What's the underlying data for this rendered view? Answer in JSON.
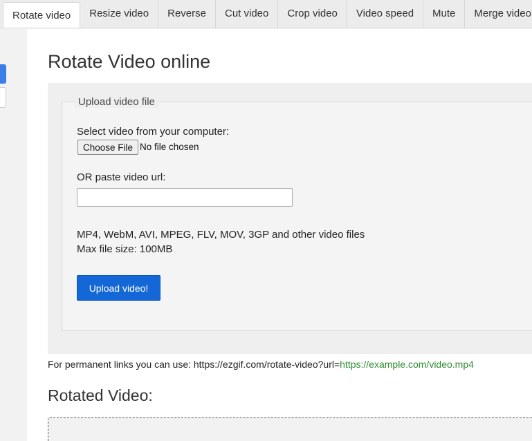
{
  "tabs": [
    {
      "label": "Rotate video",
      "active": true
    },
    {
      "label": "Resize video",
      "active": false
    },
    {
      "label": "Reverse",
      "active": false
    },
    {
      "label": "Cut video",
      "active": false
    },
    {
      "label": "Crop video",
      "active": false
    },
    {
      "label": "Video speed",
      "active": false
    },
    {
      "label": "Mute",
      "active": false
    },
    {
      "label": "Merge video",
      "active": false
    }
  ],
  "page_title": "Rotate Video online",
  "upload": {
    "legend": "Upload video file",
    "select_label": "Select video from your computer:",
    "choose_file_label": "Choose File",
    "file_status": "No file chosen",
    "url_label": "OR paste video url:",
    "url_value": "",
    "formats_text": "MP4, WebM, AVI, MPEG, FLV, MOV, 3GP and other video files",
    "max_size_text": "Max file size: 100MB",
    "upload_button_label": "Upload video!"
  },
  "permanent_links": {
    "prefix": "For permanent links you can use: https://ezgif.com/rotate-video?url=",
    "example_url": "https://example.com/video.mp4"
  },
  "result_title": "Rotated Video:",
  "colors": {
    "accent": "#1467d6",
    "link_green": "#2e8b2e"
  }
}
